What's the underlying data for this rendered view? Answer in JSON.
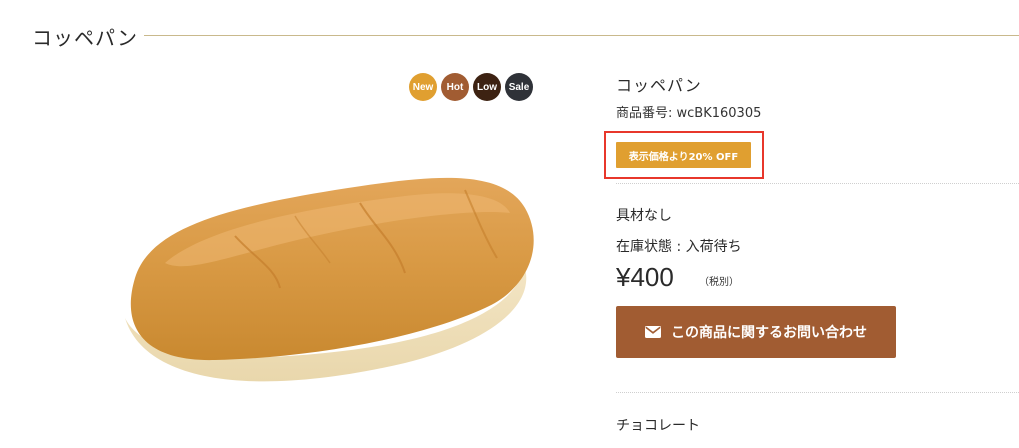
{
  "header": {
    "title": "コッペパン"
  },
  "badges": [
    {
      "label": "New",
      "color": "#e09f30"
    },
    {
      "label": "Hot",
      "color": "#a15c32"
    },
    {
      "label": "Low",
      "color": "#3d2212"
    },
    {
      "label": "Sale",
      "color": "#2f3238"
    }
  ],
  "product": {
    "name": "コッペパン",
    "code": "商品番号:  wcBK160305",
    "discount_tag": "表示価格より20% OFF",
    "option": "具材なし",
    "stock": "在庫状態 : 入荷待ち",
    "price": "¥400",
    "tax_note": "（税別）",
    "inquiry_button": "この商品に関するお問い合わせ",
    "next_option": "チョコレート"
  },
  "colors": {
    "accent": "#a15c32",
    "discount": "#e09f30",
    "highlight_border": "#e8372b"
  }
}
